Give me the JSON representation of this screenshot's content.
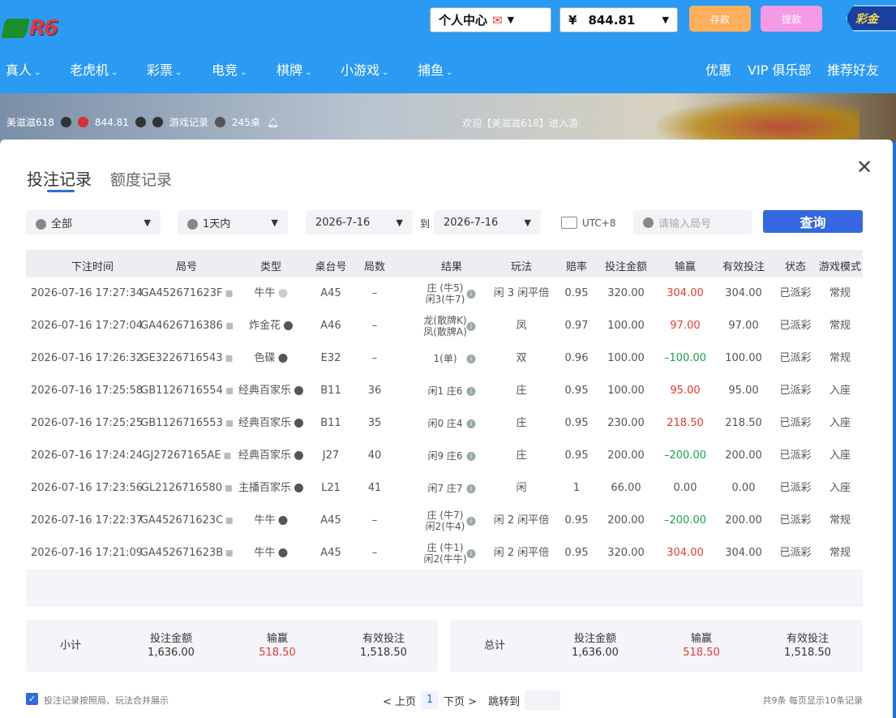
{
  "header": {
    "logo_text": "R6",
    "personal_center": "个人中心",
    "balance_symbol": "¥",
    "balance": "844.81",
    "deposit": "存款",
    "withdraw": "提款",
    "promo": "彩金"
  },
  "nav": [
    "真人",
    "老虎机",
    "彩票",
    "电竞",
    "棋牌",
    "小游戏",
    "捕鱼"
  ],
  "nav_right": [
    "优惠",
    "VIP 俱乐部",
    "推荐好友"
  ],
  "strip": {
    "username": "美滋滋618",
    "balance": "844.81",
    "game_record": "游戏记录",
    "tables": "245桌",
    "welcome": "欢迎【美滋滋618】进入游"
  },
  "modal": {
    "tab_active": "投注记录",
    "tab_inactive": "额度记录",
    "filter_all": "全部",
    "filter_range": "1天内",
    "date_from": "2026-7-16",
    "to_label": "到",
    "date_to": "2026-7-16",
    "timezone": "UTC+8",
    "round_placeholder": "请输入局号",
    "search_button": "查询"
  },
  "table": {
    "headers": [
      "下注时间",
      "局号",
      "类型",
      "桌台号",
      "局数",
      "结果",
      "玩法",
      "赔率",
      "投注金额",
      "输赢",
      "有效投注",
      "状态",
      "游戏模式"
    ],
    "rows": [
      {
        "time": "2026-07-16 17:27:34",
        "id": "GA452671623F",
        "type": "牛牛",
        "table": "A45",
        "round": "–",
        "result1": "庄 (牛5)",
        "result2": "闲3(牛7)",
        "play": "闲 3 闲平倍",
        "odds": "0.95",
        "amount": "320.00",
        "win": "304.00",
        "win_color": "red",
        "valid": "304.00",
        "status": "已派彩",
        "mode": "常规"
      },
      {
        "time": "2026-07-16 17:27:04",
        "id": "GA4626716386",
        "type": "炸金花",
        "table": "A46",
        "round": "–",
        "result1": "龙(散牌K)",
        "result2": "凤(散牌A)",
        "play": "凤",
        "odds": "0.97",
        "amount": "100.00",
        "win": "97.00",
        "win_color": "red",
        "valid": "97.00",
        "status": "已派彩",
        "mode": "常规"
      },
      {
        "time": "2026-07-16 17:26:32",
        "id": "GE3226716543",
        "type": "色碟",
        "table": "E32",
        "round": "–",
        "result1": "1(单)",
        "result2": "",
        "play": "双",
        "odds": "0.96",
        "amount": "100.00",
        "win": "–100.00",
        "win_color": "green",
        "valid": "100.00",
        "status": "已派彩",
        "mode": "常规"
      },
      {
        "time": "2026-07-16 17:25:58",
        "id": "GB1126716554",
        "type": "经典百家乐",
        "table": "B11",
        "round": "36",
        "result1": "闲1 庄6",
        "result2": "",
        "play": "庄",
        "odds": "0.95",
        "amount": "100.00",
        "win": "95.00",
        "win_color": "red",
        "valid": "95.00",
        "status": "已派彩",
        "mode": "入座"
      },
      {
        "time": "2026-07-16 17:25:25",
        "id": "GB1126716553",
        "type": "经典百家乐",
        "table": "B11",
        "round": "35",
        "result1": "闲0 庄4",
        "result2": "",
        "play": "庄",
        "odds": "0.95",
        "amount": "230.00",
        "win": "218.50",
        "win_color": "red",
        "valid": "218.50",
        "status": "已派彩",
        "mode": "入座"
      },
      {
        "time": "2026-07-16 17:24:24",
        "id": "GJ27267165AE",
        "type": "经典百家乐",
        "table": "J27",
        "round": "40",
        "result1": "闲9 庄6",
        "result2": "",
        "play": "庄",
        "odds": "0.95",
        "amount": "200.00",
        "win": "–200.00",
        "win_color": "green",
        "valid": "200.00",
        "status": "已派彩",
        "mode": "入座"
      },
      {
        "time": "2026-07-16 17:23:56",
        "id": "GL2126716580",
        "type": "主播百家乐",
        "table": "L21",
        "round": "41",
        "result1": "闲7 庄7",
        "result2": "",
        "play": "闲",
        "odds": "1",
        "amount": "66.00",
        "win": "0.00",
        "win_color": "plain",
        "valid": "0.00",
        "status": "已派彩",
        "mode": "入座"
      },
      {
        "time": "2026-07-16 17:22:37",
        "id": "GA452671623C",
        "type": "牛牛",
        "table": "A45",
        "round": "–",
        "result1": "庄 (牛7)",
        "result2": "闲2(牛4)",
        "play": "闲 2 闲平倍",
        "odds": "0.95",
        "amount": "200.00",
        "win": "–200.00",
        "win_color": "green",
        "valid": "200.00",
        "status": "已派彩",
        "mode": "常规"
      },
      {
        "time": "2026-07-16 17:21:09",
        "id": "GA452671623B",
        "type": "牛牛",
        "table": "A45",
        "round": "–",
        "result1": "庄 (牛1)",
        "result2": "闲2(牛牛)",
        "play": "闲 2 闲平倍",
        "odds": "0.95",
        "amount": "320.00",
        "win": "304.00",
        "win_color": "red",
        "valid": "304.00",
        "status": "已派彩",
        "mode": "常规"
      }
    ]
  },
  "subtotal": {
    "label": "小计",
    "bet_label": "投注金额",
    "bet": "1,636.00",
    "win_label": "输赢",
    "win": "518.50",
    "valid_label": "有效投注",
    "valid": "1,518.50"
  },
  "total": {
    "label": "总计",
    "bet_label": "投注金额",
    "bet": "1,636.00",
    "win_label": "输赢",
    "win": "518.50",
    "valid_label": "有效投注",
    "valid": "1,518.50"
  },
  "footer": {
    "merge_label": "投注记录按照局、玩法合并展示",
    "prev": "< 上页",
    "page": "1",
    "next": "下页 >",
    "jump": "跳转到",
    "summary": "共9条  每页显示10条记录"
  },
  "colors": {
    "accent": "#3568e0",
    "win": "#e53935",
    "loss": "#17a34a",
    "topbar": "#2b9af3"
  }
}
